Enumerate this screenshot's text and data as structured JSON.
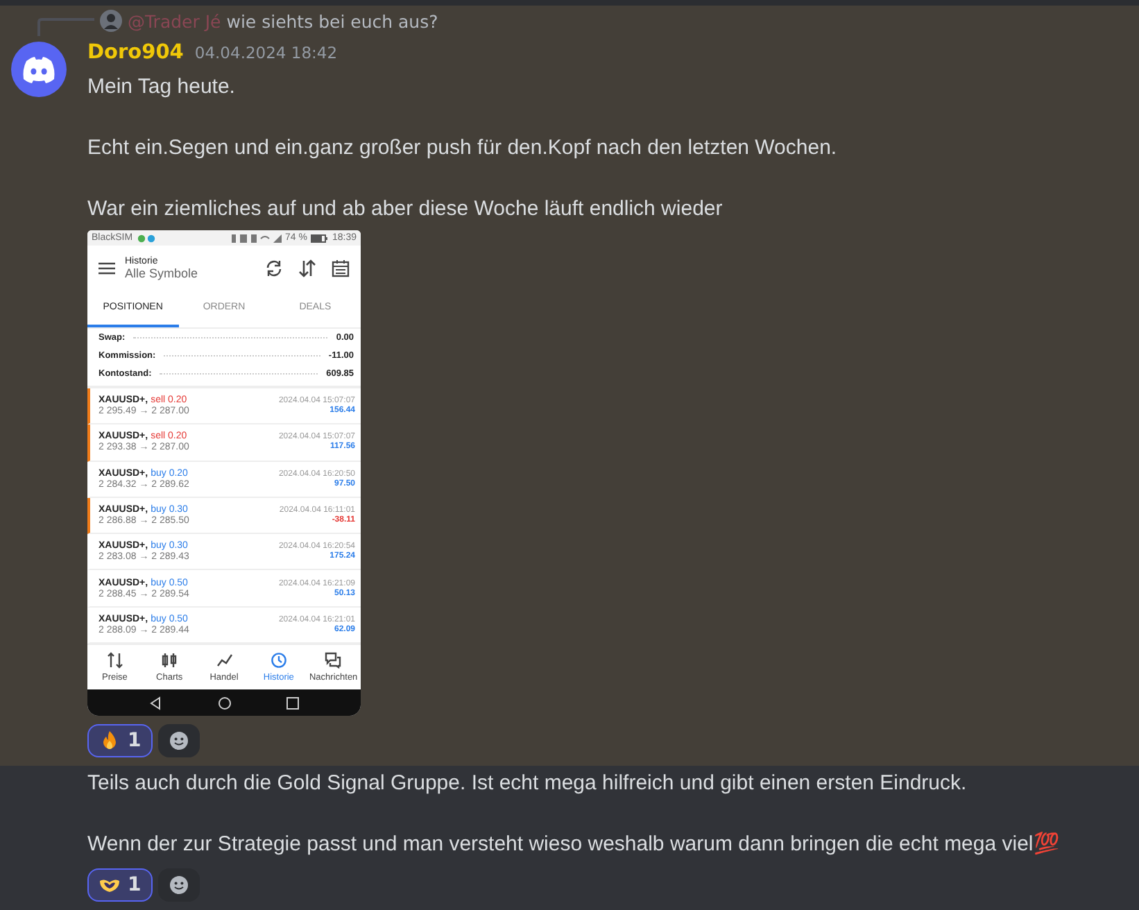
{
  "reply": {
    "author": "@Trader Jé",
    "text": "wie siehts bei euch aus?"
  },
  "message": {
    "author": "Doro904",
    "timestamp": "04.04.2024 18:42",
    "paragraphs": [
      "Mein Tag heute.",
      "Echt ein.Segen und ein.ganz großer push für den.Kopf nach den letzten Wochen.",
      "War ein ziemliches auf und ab aber diese Woche läuft endlich wieder"
    ],
    "attachment": {
      "status": {
        "carrier": "BlackSIM",
        "battery": "74 %",
        "time": "18:39"
      },
      "header": {
        "title": "Historie",
        "subtitle": "Alle Symbole"
      },
      "tabs": [
        {
          "label": "POSITIONEN",
          "selected": true
        },
        {
          "label": "ORDERN",
          "selected": false
        },
        {
          "label": "DEALS",
          "selected": false
        }
      ],
      "summary": [
        {
          "label": "Swap:",
          "value": "0.00"
        },
        {
          "label": "Kommission:",
          "value": "-11.00"
        },
        {
          "label": "Kontostand:",
          "value": "609.85"
        }
      ],
      "trades": [
        {
          "symbol": "XAUUSD+,",
          "kind": "sell",
          "volume": "sell 0.20",
          "prices": "2 295.49 → 2 287.00",
          "time": "2024.04.04 15:07:07",
          "profit": "156.44",
          "loss": false,
          "marked": true
        },
        {
          "symbol": "XAUUSD+,",
          "kind": "sell",
          "volume": "sell 0.20",
          "prices": "2 293.38 → 2 287.00",
          "time": "2024.04.04 15:07:07",
          "profit": "117.56",
          "loss": false,
          "marked": true
        },
        {
          "symbol": "XAUUSD+,",
          "kind": "buy",
          "volume": "buy 0.20",
          "prices": "2 284.32 → 2 289.62",
          "time": "2024.04.04 16:20:50",
          "profit": "97.50",
          "loss": false,
          "marked": false
        },
        {
          "symbol": "XAUUSD+,",
          "kind": "buy",
          "volume": "buy 0.30",
          "prices": "2 286.88 → 2 285.50",
          "time": "2024.04.04 16:11:01",
          "profit": "-38.11",
          "loss": true,
          "marked": true
        },
        {
          "symbol": "XAUUSD+,",
          "kind": "buy",
          "volume": "buy 0.30",
          "prices": "2 283.08 → 2 289.43",
          "time": "2024.04.04 16:20:54",
          "profit": "175.24",
          "loss": false,
          "marked": false
        },
        {
          "symbol": "XAUUSD+,",
          "kind": "buy",
          "volume": "buy 0.50",
          "prices": "2 288.45 → 2 289.54",
          "time": "2024.04.04 16:21:09",
          "profit": "50.13",
          "loss": false,
          "marked": false
        },
        {
          "symbol": "XAUUSD+,",
          "kind": "buy",
          "volume": "buy 0.50",
          "prices": "2 288.09 → 2 289.44",
          "time": "2024.04.04 16:21:01",
          "profit": "62.09",
          "loss": false,
          "marked": false
        }
      ],
      "nav": [
        {
          "kind": "prices",
          "label": "Preise",
          "selected": false
        },
        {
          "kind": "charts",
          "label": "Charts",
          "selected": false
        },
        {
          "kind": "trade",
          "label": "Handel",
          "selected": false
        },
        {
          "kind": "history",
          "label": "Historie",
          "selected": true
        },
        {
          "kind": "messages",
          "label": "Nachrichten",
          "selected": false
        }
      ]
    },
    "reactions": [
      {
        "kind": "fire",
        "count": "1",
        "selected": true
      }
    ]
  },
  "followup": {
    "paragraphs": [
      "Teils auch durch die Gold Signal Gruppe. Ist echt mega hilfreich und gibt einen ersten Eindruck.",
      "Wenn der zur Strategie passt und man versteht wieso weshalb warum dann bringen die echt mega viel💯"
    ],
    "reactions": [
      {
        "kind": "heart-hands",
        "count": "1",
        "selected": true
      }
    ]
  }
}
